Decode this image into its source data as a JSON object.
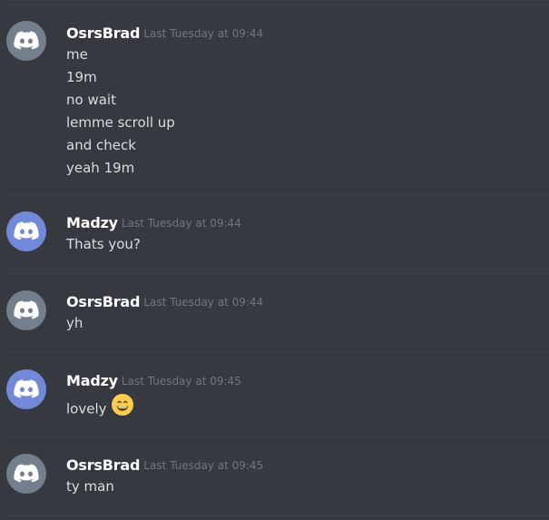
{
  "colors": {
    "background": "#36393f",
    "divider": "#40434a",
    "username": "#ffffff",
    "timestamp": "#72767d",
    "text": "#dcddde",
    "avatar_grey": "#747f8d",
    "avatar_blurple": "#7289da"
  },
  "messages": [
    {
      "username": "OsrsBrad",
      "timestamp": "Last Tuesday at 09:44",
      "avatar": "discord-logo-icon",
      "avatar_color": "#747f8d",
      "lines": [
        "me",
        "19m",
        "no wait",
        "lemme scroll up",
        "and check",
        "yeah 19m"
      ]
    },
    {
      "username": "Madzy",
      "timestamp": "Last Tuesday at 09:44",
      "avatar": "discord-logo-icon",
      "avatar_color": "#7289da",
      "lines": [
        "Thats you?"
      ]
    },
    {
      "username": "OsrsBrad",
      "timestamp": "Last Tuesday at 09:44",
      "avatar": "discord-logo-icon",
      "avatar_color": "#747f8d",
      "lines": [
        "yh"
      ]
    },
    {
      "username": "Madzy",
      "timestamp": "Last Tuesday at 09:45",
      "avatar": "discord-logo-icon",
      "avatar_color": "#7289da",
      "lines": [
        "lovely"
      ],
      "emoji": "grinning-face-icon"
    },
    {
      "username": "OsrsBrad",
      "timestamp": "Last Tuesday at 09:45",
      "avatar": "discord-logo-icon",
      "avatar_color": "#747f8d",
      "lines": [
        "ty man"
      ]
    }
  ]
}
